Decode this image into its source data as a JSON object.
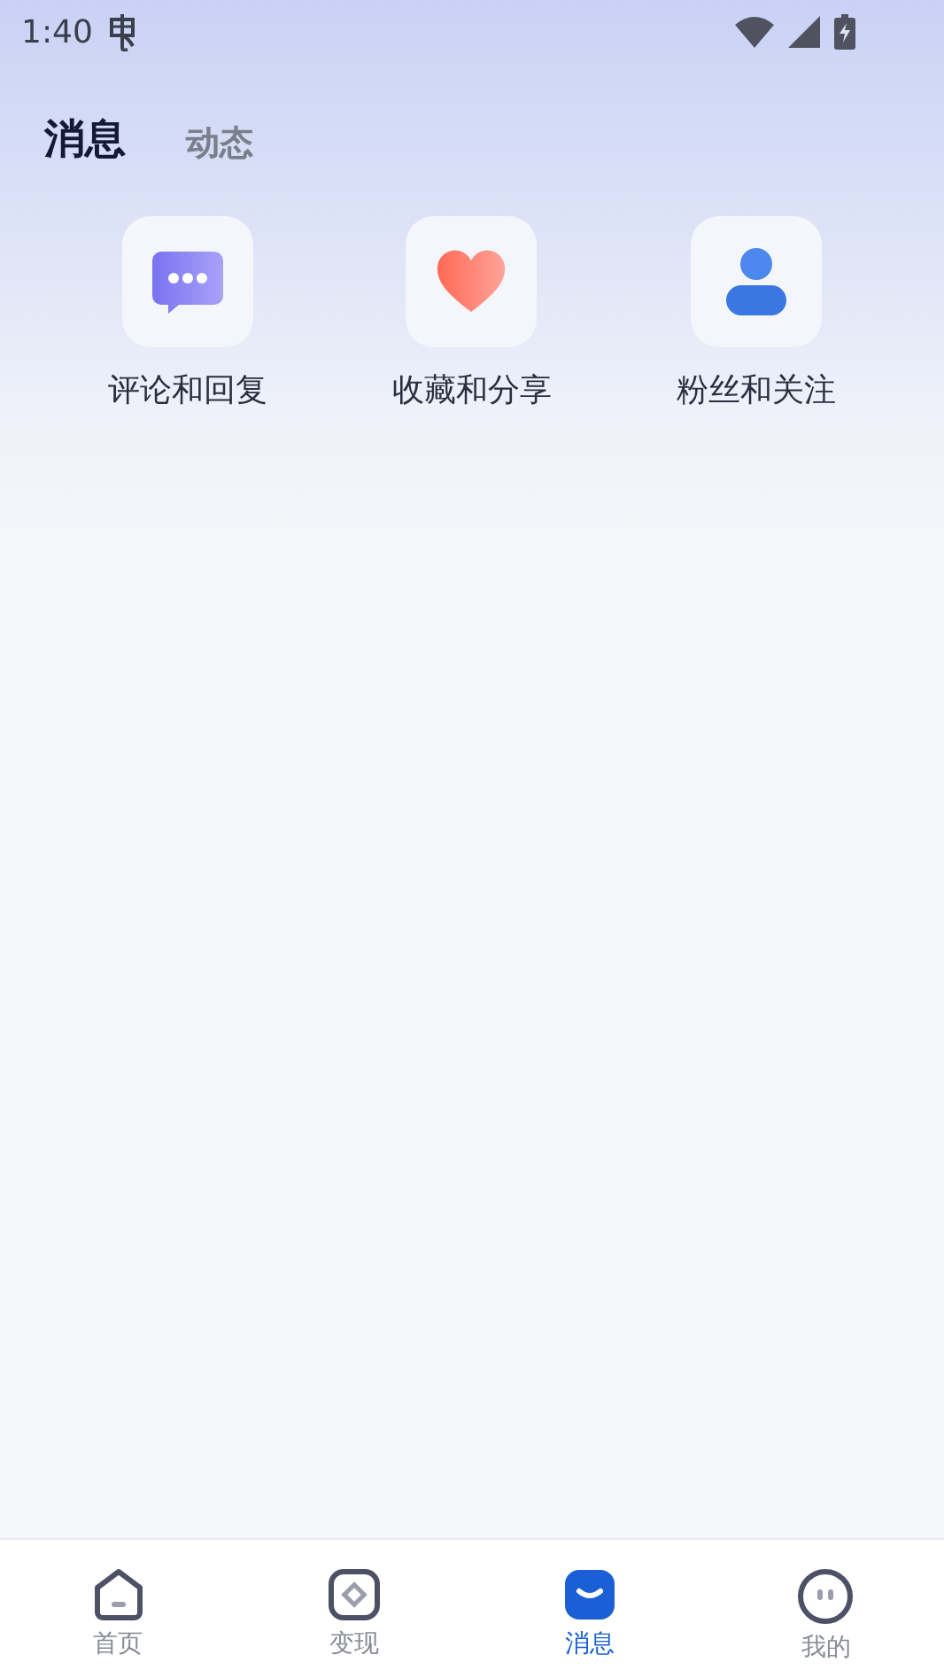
{
  "status_bar": {
    "time": "1:40"
  },
  "tabs": [
    {
      "label": "消息",
      "selected": true
    },
    {
      "label": "动态",
      "selected": false
    }
  ],
  "shortcuts": [
    {
      "kind": "comment",
      "label": "评论和回复"
    },
    {
      "kind": "heart",
      "label": "收藏和分享"
    },
    {
      "kind": "person",
      "label": "粉丝和关注"
    }
  ],
  "bottom_nav": [
    {
      "kind": "home",
      "label": "首页",
      "selected": false
    },
    {
      "kind": "earn",
      "label": "变现",
      "selected": false
    },
    {
      "kind": "message",
      "label": "消息",
      "selected": true
    },
    {
      "kind": "me",
      "label": "我的",
      "selected": false
    }
  ]
}
